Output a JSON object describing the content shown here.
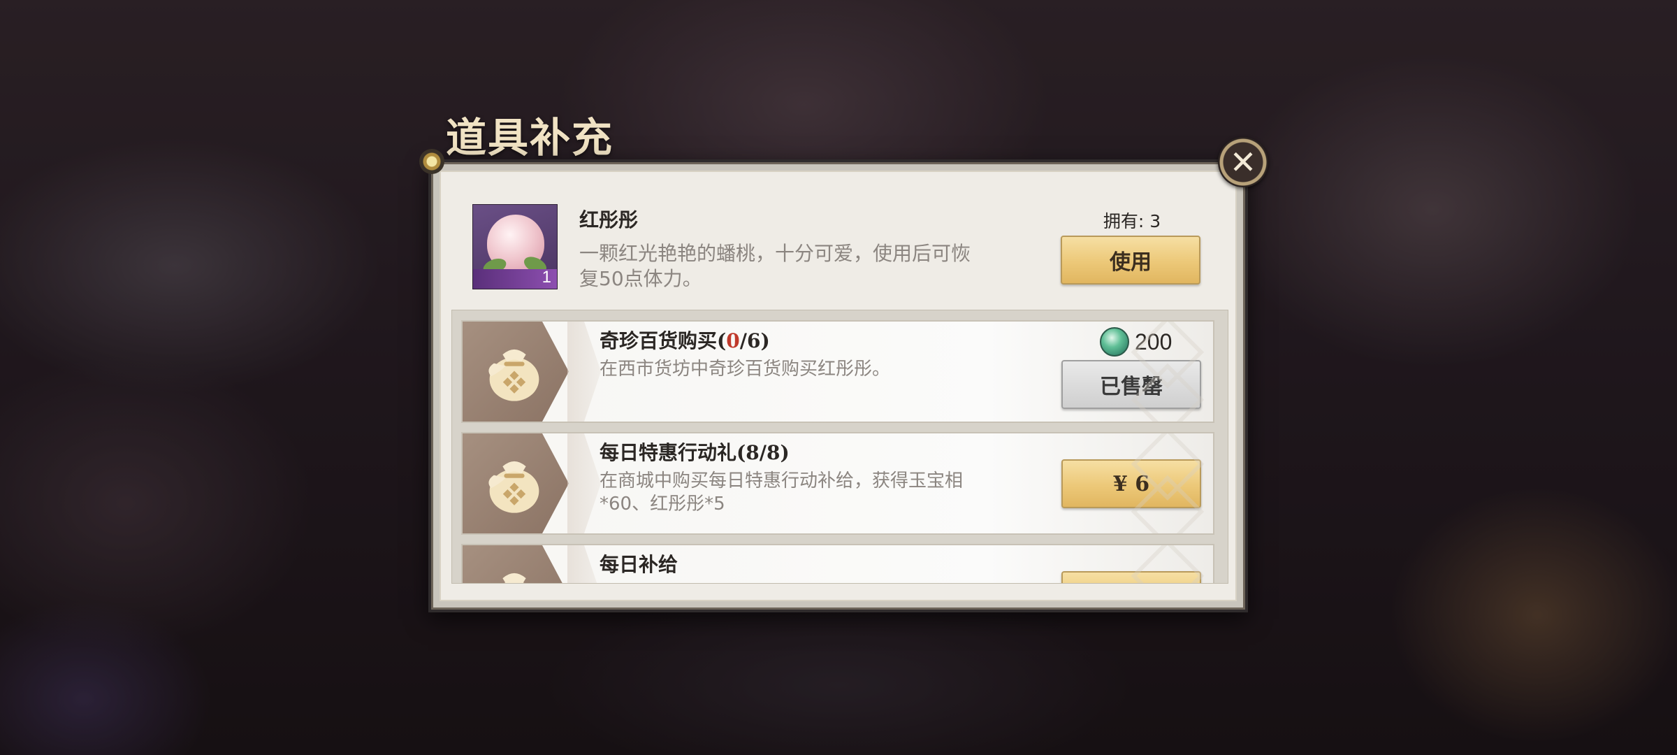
{
  "dialog": {
    "title": "道具补充",
    "close_icon": "close-icon"
  },
  "item": {
    "name": "红彤彤",
    "description": "一颗红光艳艳的蟠桃，十分可爱，使用后可恢复50点体力。",
    "count": "1",
    "owned_label": "拥有: 3",
    "use_button": "使用"
  },
  "offers": [
    {
      "title_prefix": "奇珍百货购买(",
      "title_highlight": "0",
      "title_suffix": "/6)",
      "description": "在西市货坊中奇珍百货购买红彤彤。",
      "price_icon": "jade-gem-icon",
      "price": "200",
      "button": "已售罄",
      "status": "sold-out"
    },
    {
      "title": "每日特惠行动礼(8/8)",
      "description": "在商城中购买每日特惠行动补给，获得玉宝相*60、红彤彤*5",
      "button": "¥ 6"
    },
    {
      "title": "每日补给"
    }
  ],
  "colors": {
    "gold_button": "#ecc878",
    "highlight_red": "#c0392b",
    "panel_bg": "#efece6"
  }
}
